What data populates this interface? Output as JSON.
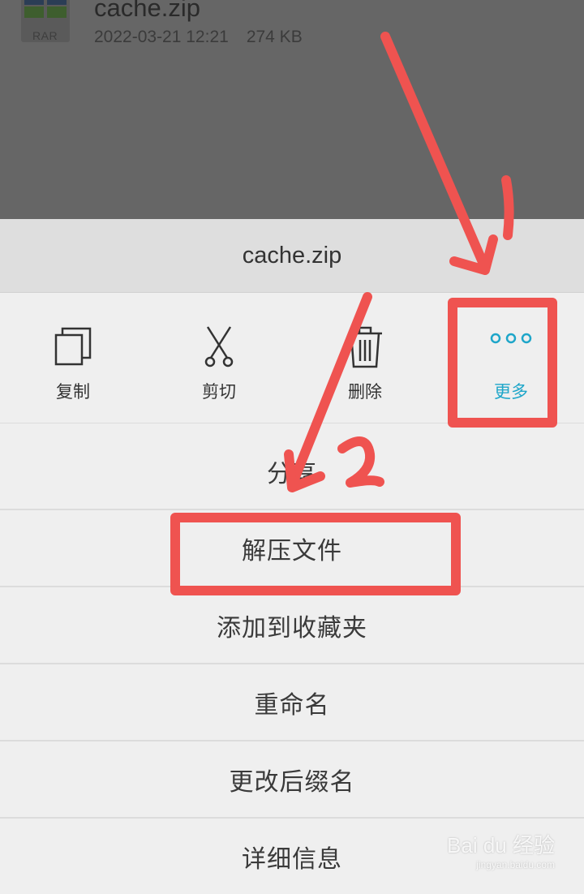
{
  "background_file": {
    "icon_text": "RAR",
    "name": "cache.zip",
    "date": "2022-03-21 12:21",
    "size": "274 KB"
  },
  "sheet": {
    "title": "cache.zip",
    "actions": [
      {
        "label": "复制",
        "icon": "copy-icon"
      },
      {
        "label": "剪切",
        "icon": "scissors-icon"
      },
      {
        "label": "删除",
        "icon": "trash-icon"
      },
      {
        "label": "更多",
        "icon": "more-icon"
      }
    ],
    "menu": [
      {
        "label": "分享"
      },
      {
        "label": "解压文件"
      },
      {
        "label": "添加到收藏夹"
      },
      {
        "label": "重命名"
      },
      {
        "label": "更改后缀名"
      },
      {
        "label": "详细信息"
      }
    ]
  },
  "annotations": {
    "step1": "1",
    "step2": "2",
    "color": "#ef5350"
  },
  "watermark": {
    "main": "Bai du 经验",
    "sub": "jingyan.baidu.com"
  },
  "colors": {
    "accent": "#1ea6c9",
    "backdrop": "#666666",
    "sheet_bg": "#efefef",
    "title_bg": "#dedede"
  }
}
